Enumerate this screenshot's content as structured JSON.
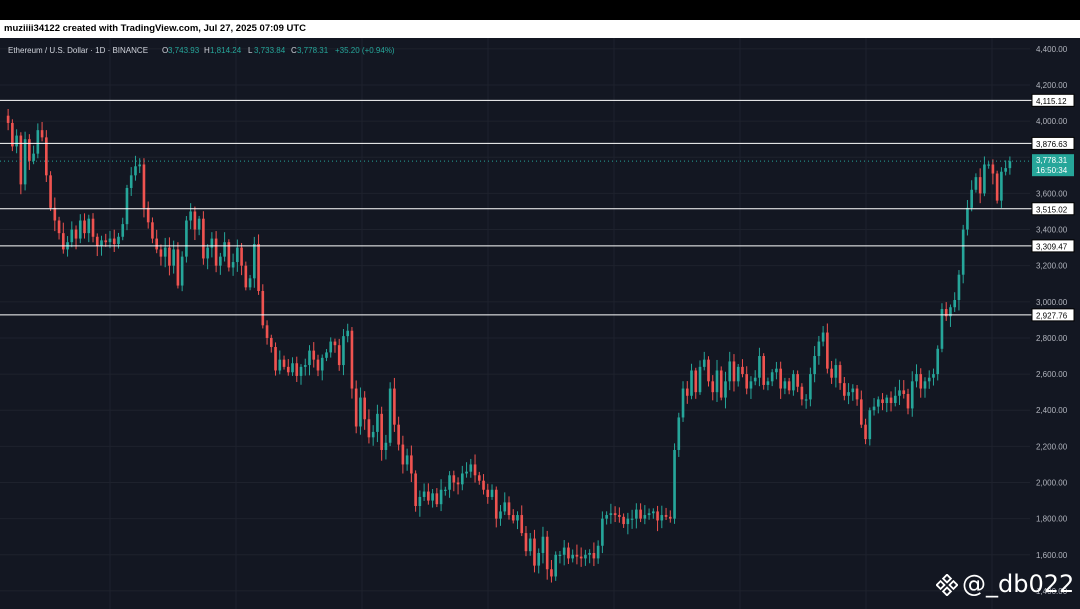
{
  "header": {
    "credit": "muziiii34122 created with TradingView.com, Jul 27, 2025 07:09 UTC"
  },
  "legend": {
    "symbol": "Ethereum / U.S. Dollar · 1D · BINANCE",
    "o_label": "O",
    "o_value": "3,743.93",
    "h_label": "H",
    "h_value": "1,814.24",
    "l_label": "L",
    "l_value": "3,733.84",
    "c_label": "C",
    "c_value": "3,778.31",
    "change": "+35.20 (+0.94%)"
  },
  "watermark": {
    "text": "@_db022",
    "icon": "binance-logo-icon"
  },
  "colors": {
    "background": "#131722",
    "up": "#26a69a",
    "down": "#ef5350",
    "grid": "#1e222d",
    "level_line": "#ffffff",
    "axis_text": "#b2b5be",
    "price_tag": "#26a69a"
  },
  "chart_data": {
    "type": "candlestick",
    "title": "Ethereum / U.S. Dollar · 1D · BINANCE",
    "ylim": [
      1300,
      4460
    ],
    "y_ticks": [
      "4,400.00",
      "4,200.00",
      "4,000.00",
      "3,800.00",
      "3,600.00",
      "3,400.00",
      "3,200.00",
      "3,000.00",
      "2,800.00",
      "2,600.00",
      "2,400.00",
      "2,200.00",
      "2,000.00",
      "1,800.00",
      "1,600.00",
      "1,400.00"
    ],
    "y_tick_values": [
      4400,
      4200,
      4000,
      3800,
      3600,
      3400,
      3200,
      3000,
      2800,
      2600,
      2400,
      2200,
      2000,
      1800,
      1600,
      1400
    ],
    "grid": true,
    "horizontal_levels": [
      {
        "value": 4115.12,
        "label": "4,115.12"
      },
      {
        "value": 3876.63,
        "label": "3,876.63"
      },
      {
        "value": 3515.02,
        "label": "3,515.02"
      },
      {
        "value": 3309.47,
        "label": "3,309.47"
      },
      {
        "value": 2927.76,
        "label": "2,927.76"
      }
    ],
    "last_price": {
      "value": 3778.31,
      "label": "3,778.31",
      "countdown": "16:50:34"
    },
    "closes": [
      3990,
      3860,
      3920,
      3650,
      3900,
      3780,
      3820,
      3950,
      3910,
      3700,
      3520,
      3450,
      3380,
      3290,
      3330,
      3400,
      3350,
      3450,
      3380,
      3460,
      3360,
      3310,
      3340,
      3330,
      3350,
      3320,
      3360,
      3430,
      3630,
      3700,
      3750,
      3760,
      3520,
      3440,
      3350,
      3290,
      3250,
      3300,
      3200,
      3290,
      3090,
      3250,
      3450,
      3500,
      3400,
      3460,
      3240,
      3300,
      3350,
      3200,
      3250,
      3330,
      3190,
      3220,
      3300,
      3200,
      3080,
      3130,
      3320,
      3060,
      2870,
      2800,
      2750,
      2620,
      2680,
      2640,
      2610,
      2660,
      2590,
      2640,
      2650,
      2730,
      2680,
      2620,
      2690,
      2720,
      2780,
      2760,
      2650,
      2810,
      2840,
      2520,
      2310,
      2470,
      2350,
      2250,
      2280,
      2380,
      2180,
      2220,
      2520,
      2320,
      2210,
      2100,
      2150,
      2050,
      1870,
      1920,
      1950,
      1900,
      1940,
      1880,
      1960,
      1960,
      2040,
      2000,
      1990,
      2050,
      2060,
      2100,
      2040,
      2010,
      1960,
      1920,
      1960,
      1800,
      1840,
      1890,
      1820,
      1790,
      1820,
      1720,
      1620,
      1690,
      1540,
      1610,
      1700,
      1520,
      1480,
      1600,
      1600,
      1640,
      1580,
      1600,
      1590,
      1580,
      1600,
      1610,
      1580,
      1650,
      1800,
      1820,
      1830,
      1820,
      1810,
      1770,
      1800,
      1800,
      1850,
      1800,
      1820,
      1830,
      1840,
      1790,
      1820,
      1810,
      1800,
      2180,
      2360,
      2520,
      2480,
      2620,
      2500,
      2640,
      2680,
      2560,
      2500,
      2620,
      2470,
      2560,
      2670,
      2560,
      2640,
      2600,
      2520,
      2560,
      2580,
      2700,
      2540,
      2560,
      2610,
      2630,
      2520,
      2560,
      2510,
      2600,
      2530,
      2460,
      2460,
      2600,
      2700,
      2780,
      2830,
      2630,
      2580,
      2650,
      2550,
      2480,
      2500,
      2520,
      2460,
      2320,
      2240,
      2400,
      2420,
      2460,
      2440,
      2470,
      2440,
      2480,
      2510,
      2490,
      2410,
      2560,
      2600,
      2520,
      2560,
      2580,
      2600,
      2740,
      2960,
      2920,
      2970,
      3010,
      3150,
      3400,
      3520,
      3620,
      3690,
      3600,
      3760,
      3760,
      3710,
      3560,
      3720,
      3740,
      3778
    ]
  }
}
